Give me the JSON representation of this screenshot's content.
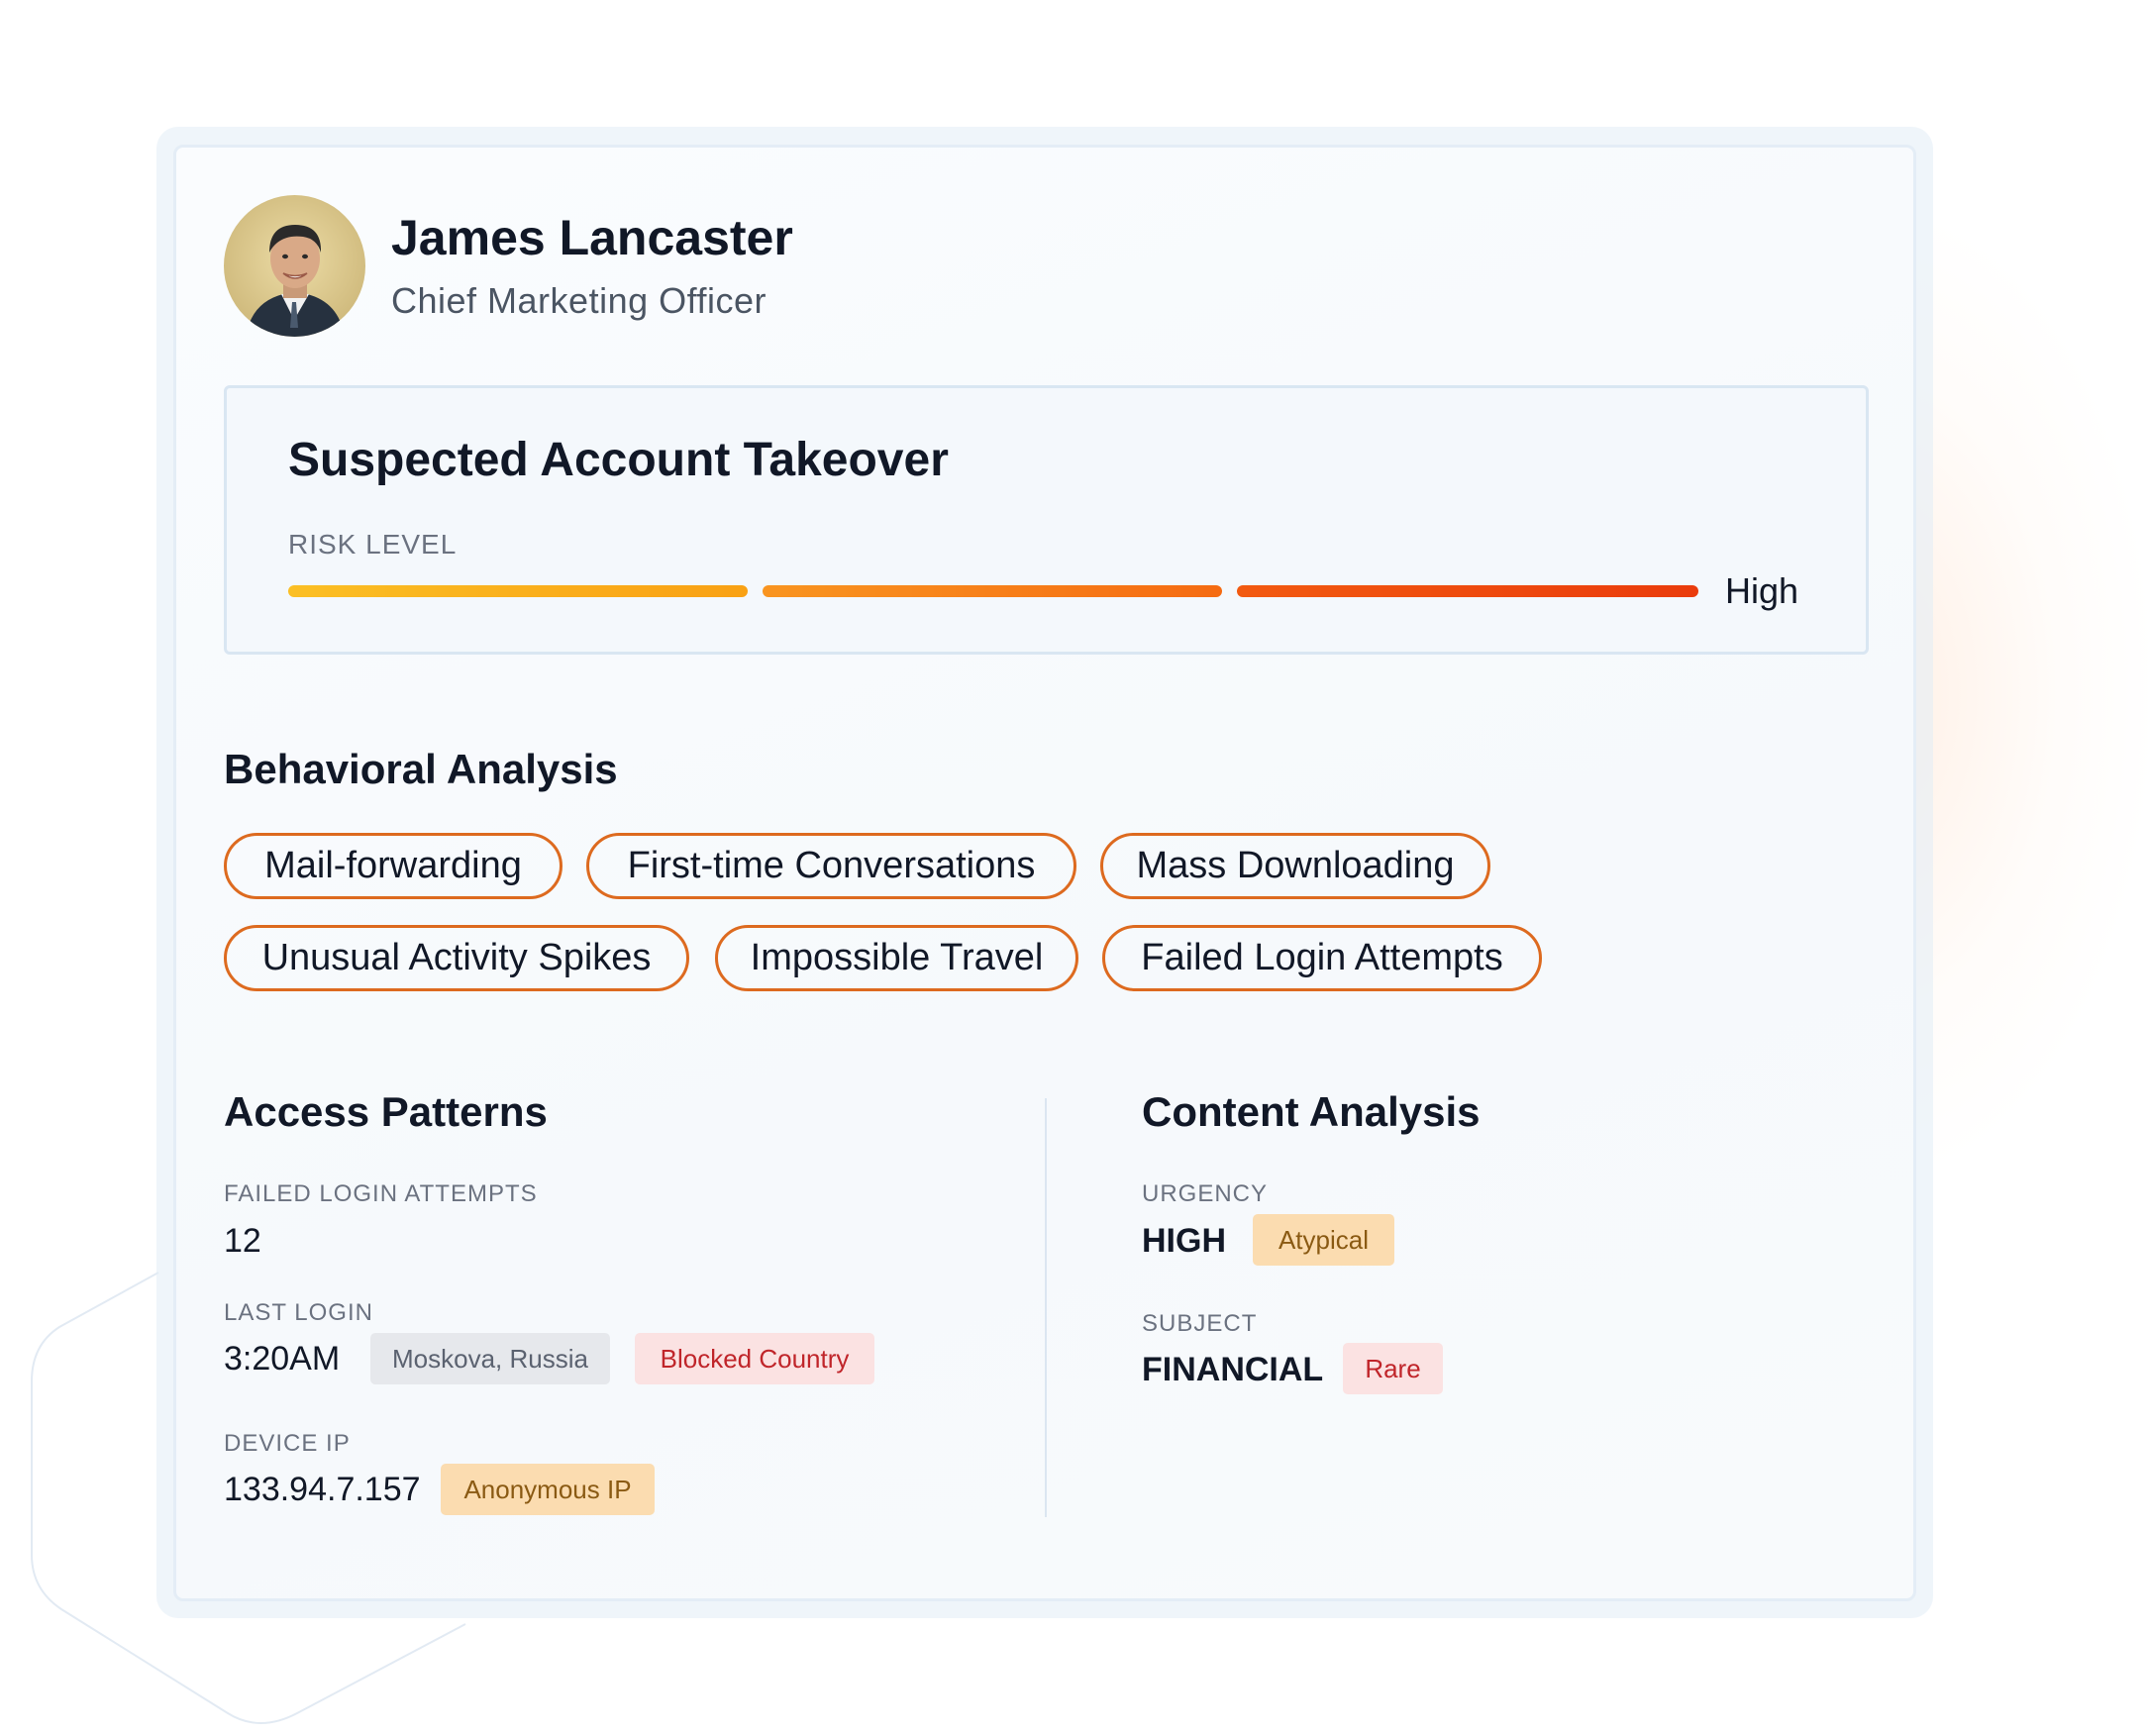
{
  "profile": {
    "name": "James Lancaster",
    "role": "Chief Marketing Officer"
  },
  "alert": {
    "title": "Suspected Account Takeover",
    "risk_label": "RISK LEVEL",
    "risk_value": "High",
    "risk_colors": [
      "#fbbf24",
      "#f97316",
      "#ea3c0c"
    ]
  },
  "behavioral": {
    "title": "Behavioral Analysis",
    "tags": [
      "Mail-forwarding",
      "First-time Conversations",
      "Mass Downloading",
      "Unusual Activity Spikes",
      "Impossible Travel",
      "Failed Login Attempts"
    ]
  },
  "access": {
    "title": "Access Patterns",
    "failed_login": {
      "label": "FAILED LOGIN ATTEMPTS",
      "value": "12"
    },
    "last_login": {
      "label": "LAST LOGIN",
      "value": "3:20AM",
      "location": "Moskova, Russia",
      "flag": "Blocked Country"
    },
    "device_ip": {
      "label": "DEVICE IP",
      "value": "133.94.7.157",
      "flag": "Anonymous IP"
    }
  },
  "content": {
    "title": "Content Analysis",
    "urgency": {
      "label": "URGENCY",
      "value": "HIGH",
      "flag": "Atypical"
    },
    "subject": {
      "label": "SUBJECT",
      "value": "FINANCIAL",
      "flag": "Rare"
    }
  },
  "colors": {
    "accent_orange": "#dd6a1f",
    "text_primary": "#111827",
    "text_muted": "#6b7280"
  }
}
